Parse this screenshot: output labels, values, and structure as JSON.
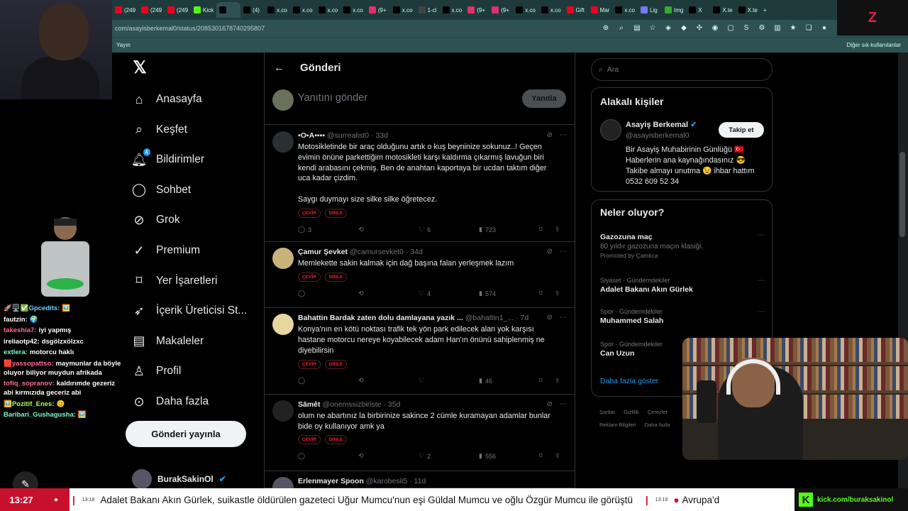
{
  "browser": {
    "tabs": [
      "(249",
      "(249",
      "(249",
      "Kick",
      "",
      "(4)",
      "x.co",
      "x.co",
      "x.co",
      "x.co",
      "(9+",
      "x.co",
      "1-cl",
      "x.co",
      "(9+",
      "(9+",
      "x.co",
      "x.co",
      "Gift",
      "Mar",
      "x.co",
      "Lig",
      "Img",
      "X",
      "X.te",
      "X.te"
    ],
    "url": "com/asayisberkemal0/status/2085301678740295807",
    "bookmarks_left": "Yayın",
    "bookmarks_right": "Diğer sık kullanılanlar"
  },
  "nav": {
    "items": [
      {
        "label": "Anasayfa",
        "icon": "home-icon"
      },
      {
        "label": "Keşfet",
        "icon": "search-icon"
      },
      {
        "label": "Bildirimler",
        "icon": "bell-icon",
        "badge": "4"
      },
      {
        "label": "Sohbet",
        "icon": "chat-icon"
      },
      {
        "label": "Grok",
        "icon": "grok-icon"
      },
      {
        "label": "Premium",
        "icon": "premium-icon"
      },
      {
        "label": "Yer İşaretleri",
        "icon": "bookmark-icon"
      },
      {
        "label": "İçerik Üreticisi St...",
        "icon": "rocket-icon"
      },
      {
        "label": "Makaleler",
        "icon": "article-icon"
      },
      {
        "label": "Profil",
        "icon": "person-icon"
      },
      {
        "label": "Daha fazla",
        "icon": "more-circle-icon"
      }
    ],
    "post_button": "Gönderi yayınla",
    "profile_name": "BurakSakinOl"
  },
  "main": {
    "title": "Gönderi",
    "reply_placeholder": "Yanıtını gönder",
    "reply_button": "Yanıtla",
    "translate": "ÇEVİR",
    "listen": "DİNLE",
    "tweets": [
      {
        "name": "▪O▪A▪▪▪▪",
        "handle": "@surrealist0 · 33d",
        "text": "Motosikletinde bir araç olduğunu artık o kuş beyninize sokunuz..! Geçen evimin önüne parkettiğim motosikleti karşı kaldırma çıkarmış lavuğun biri kendi arabasını çekmiş. Ben de anahtarı kaportaya bir ucdan taktım diğer uca kadar çizdim.\n\nSaygı duymayı size silke silke öğretecez.",
        "replies": "3",
        "reposts": "",
        "likes": "6",
        "views": "723"
      },
      {
        "name": "Çamur Şevket",
        "handle": "@camursevket0 · 34d",
        "text": "Memlekette sakin kalmak için dağ başına falan yerleşmek lazım",
        "replies": "",
        "reposts": "",
        "likes": "4",
        "views": "574"
      },
      {
        "name": "Bahattin Bardak zaten dolu damlayana yazık ...",
        "handle": "@bahattin1_... · 7d",
        "text": "Konya'nın en kötü noktası trafik tek yön park edilecek alan yok karşısı hastane motorcu nereye koyabilecek adam Han'ın önünü sahiplenmiş ne diyebilirsin",
        "replies": "",
        "reposts": "",
        "likes": "",
        "views": "46"
      },
      {
        "name": "Sāmêt",
        "handle": "@onemssizbiriste · 35d",
        "text": "olum ne abartınız la birbirinize sakince 2 cümle kuramayan adamlar bunlar bide oy kullanıyor amk ya",
        "replies": "",
        "reposts": "",
        "likes": "2",
        "views": "556"
      },
      {
        "name": "Erlenmayer Spoon",
        "handle": "@karobesli5 · 11d",
        "text": "",
        "replies": "",
        "reposts": "",
        "likes": "",
        "views": ""
      }
    ]
  },
  "right": {
    "search_placeholder": "Ara",
    "related_title": "Alakalı kişiler",
    "related_name": "Asayiş Berkemal",
    "related_handle": "@asayisberkemal0",
    "follow_button": "Takip et",
    "related_bio": "Bir Asayiş Muhabirinin Günlüğü 🇹🇷 Haberlerin ana kaynağındasınız 😎 Takibe almayı unutma 😉 ihbar hattım 0532 609 52 34",
    "trends_title": "Neler oluyor?",
    "trends": [
      {
        "ctx": "",
        "title": "Gazozuna maç",
        "sub": "80 yıldır gazozuna maçın klasiği.",
        "promo": "Promoted by Çamlıca"
      },
      {
        "ctx": "Siyaset · Gündemdekiler",
        "title": "Adalet Bakanı Akın Gürlek",
        "sub": "",
        "promo": ""
      },
      {
        "ctx": "Spor · Gündemdekiler",
        "title": "Muhammed Salah",
        "sub": "",
        "promo": ""
      },
      {
        "ctx": "Spor · Gündemdekiler",
        "title": "Can Uzun",
        "sub": "",
        "promo": ""
      }
    ],
    "show_more": "Daha fazla göster",
    "footer": [
      "Şartlar",
      "Gizlilik",
      "Çerezler",
      "Reklam Bilgileri",
      "Daha fazla"
    ]
  },
  "chat": [
    {
      "user": "🚀🖥️✅Gpcedits:",
      "msg": "🖼️",
      "color": "#7ad0ff"
    },
    {
      "user": "fautzin:",
      "msg": "🌍",
      "color": "#ffffff"
    },
    {
      "user": "takeshia7:",
      "msg": "iyi yapmış",
      "color": "#ff6b9a"
    },
    {
      "user": "ireliaotp42:",
      "msg": "dsgölzxölzxc",
      "color": "#ffffff"
    },
    {
      "user": "extlera:",
      "msg": "motorcu haklı",
      "color": "#7affc8"
    },
    {
      "user": "🟥yassopattso:",
      "msg": "maymunlar da böyle oluyor biliyor muydun afrikada",
      "color": "#ff6b9a"
    },
    {
      "user": "tofiq_sopranov:",
      "msg": "kaldırımde gezeriz abi kırmızıda geceriz abi",
      "color": "#ff6b9a"
    },
    {
      "user": "🖼️Pozitif_Enes:",
      "msg": "😊",
      "color": "#a6ff5a"
    },
    {
      "user": "Baribari_Gushagusha:",
      "msg": "🖼️",
      "color": "#7affc8"
    }
  ],
  "ticker": {
    "time": "13:27",
    "stamp1": "13:18",
    "headline1": "Adalet Bakanı Akın Gürlek, suikastle öldürülen gazeteci Uğur Mumcu'nun eşi Güldal Mumcu ve oğlu Özgür Mumcu ile görüştü",
    "stamp2": "13:19",
    "headline2": "Avrupa'd",
    "kick_url": "kick.com/buraksakinol"
  },
  "colors": {
    "accent": "#1d9bf0",
    "ticker_red": "#c8102e",
    "kick_green": "#53fc18",
    "browser": "#2e5252"
  }
}
